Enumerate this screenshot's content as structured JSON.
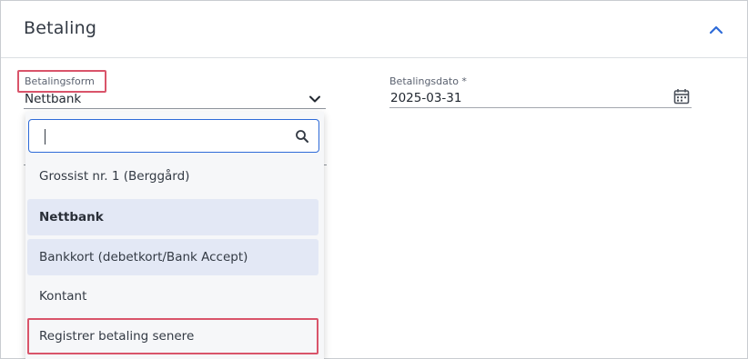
{
  "section": {
    "title": "Betaling",
    "collapse_icon": "chevron-up-icon",
    "accent_color": "#2e6bd8"
  },
  "payment_method": {
    "label": "Betalingsform",
    "value": "Nettbank",
    "icon": "chevron-down-icon"
  },
  "payment_date": {
    "label": "Betalingsdato *",
    "value": "2025-03-31",
    "icon": "calendar-icon"
  },
  "dropdown": {
    "search_value": "",
    "search_icon": "search-icon",
    "options": [
      {
        "label": "Grossist nr. 1 (Berggård)"
      },
      {
        "label": "Nettbank"
      },
      {
        "label": "Bankkort (debetkort/Bank Accept)"
      },
      {
        "label": "Kontant"
      },
      {
        "label": "Registrer betaling senere"
      }
    ]
  },
  "highlight_color": "#d9546a"
}
